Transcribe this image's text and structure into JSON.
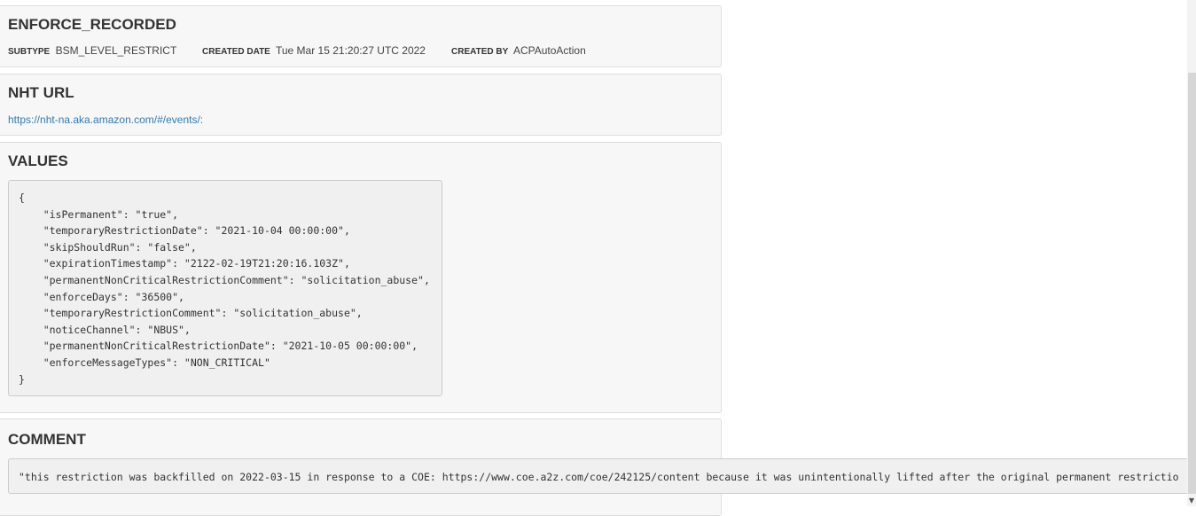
{
  "enforce": {
    "title": "ENFORCE_RECORDED",
    "subtype_label": "SUBTYPE",
    "subtype_value": "BSM_LEVEL_RESTRICT",
    "created_date_label": "CREATED DATE",
    "created_date_value": "Tue Mar 15 21:20:27 UTC 2022",
    "created_by_label": "CREATED BY",
    "created_by_value": "ACPAutoAction"
  },
  "nht": {
    "title": "NHT URL",
    "url": "https://nht-na.aka.amazon.com/#/events/:"
  },
  "values": {
    "title": "VALUES",
    "json_text": "{\n    \"isPermanent\": \"true\",\n    \"temporaryRestrictionDate\": \"2021-10-04 00:00:00\",\n    \"skipShouldRun\": \"false\",\n    \"expirationTimestamp\": \"2122-02-19T21:20:16.103Z\",\n    \"permanentNonCriticalRestrictionComment\": \"solicitation_abuse\",\n    \"enforceDays\": \"36500\",\n    \"temporaryRestrictionComment\": \"solicitation_abuse\",\n    \"noticeChannel\": \"NBUS\",\n    \"permanentNonCriticalRestrictionDate\": \"2021-10-05 00:00:00\",\n    \"enforceMessageTypes\": \"NON_CRITICAL\"\n}"
  },
  "comment": {
    "title": "COMMENT",
    "text": "\"this restriction was backfilled on 2022-03-15 in response to a COE: https://www.coe.a2z.com/coe/242125/content because it was unintentionally lifted after the original permanent restrictio"
  },
  "scrollbar": {
    "down_arrow_icon": "chevron-down-icon"
  }
}
